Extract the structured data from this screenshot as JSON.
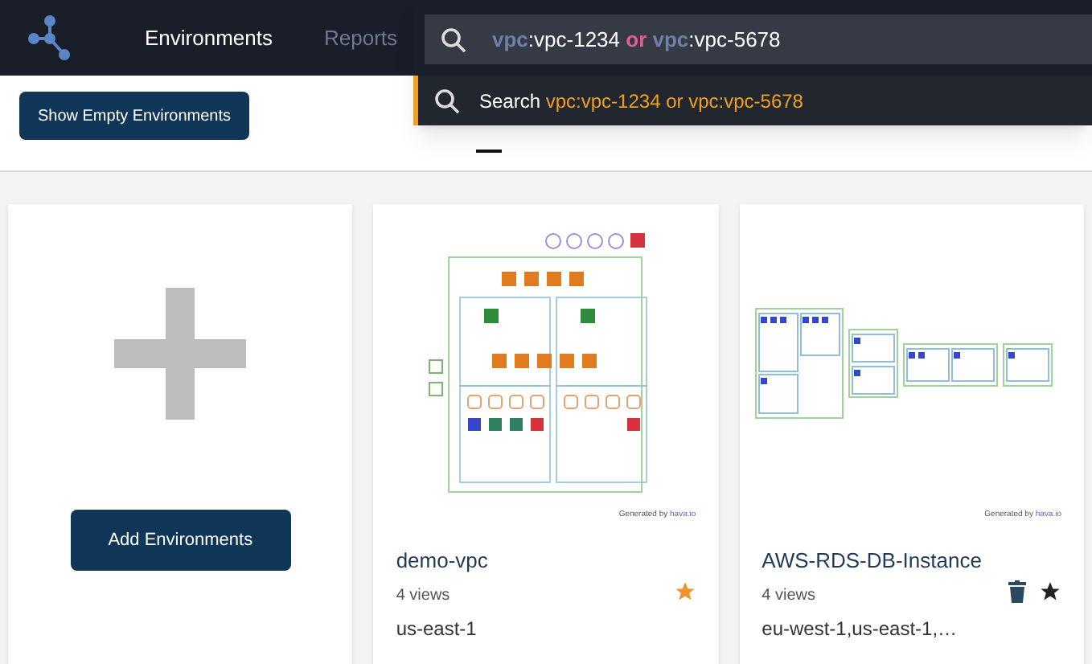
{
  "nav": {
    "items": [
      {
        "label": "Environments",
        "selected": true
      },
      {
        "label": "Reports",
        "selected": false
      }
    ]
  },
  "search": {
    "tokens": [
      {
        "kind": "key",
        "text": "vpc"
      },
      {
        "kind": "sep",
        "text": ":"
      },
      {
        "kind": "value",
        "text": "vpc-1234"
      },
      {
        "kind": "op",
        "text": " or "
      },
      {
        "kind": "key",
        "text": "vpc"
      },
      {
        "kind": "sep",
        "text": ":"
      },
      {
        "kind": "value",
        "text": "vpc-5678"
      }
    ],
    "suggestion": {
      "label": "Search",
      "query": "vpc:vpc-1234 or vpc:vpc-5678"
    }
  },
  "toolbar": {
    "button": "Show Empty Environments"
  },
  "tab_underline": true,
  "add_card": {
    "button": "Add Environments"
  },
  "environments": [
    {
      "name": "demo-vpc",
      "views": "4 views",
      "regions": "us-east-1",
      "credit": "Generated by",
      "credit_brand": "hava.io",
      "favorite": true,
      "show_delete": false
    },
    {
      "name": "AWS-RDS-DB-Instance",
      "views": "4 views",
      "regions": "eu-west-1,us-east-1,…",
      "credit": "Generated by",
      "credit_brand": "hava.io",
      "favorite": false,
      "show_delete": true
    }
  ]
}
